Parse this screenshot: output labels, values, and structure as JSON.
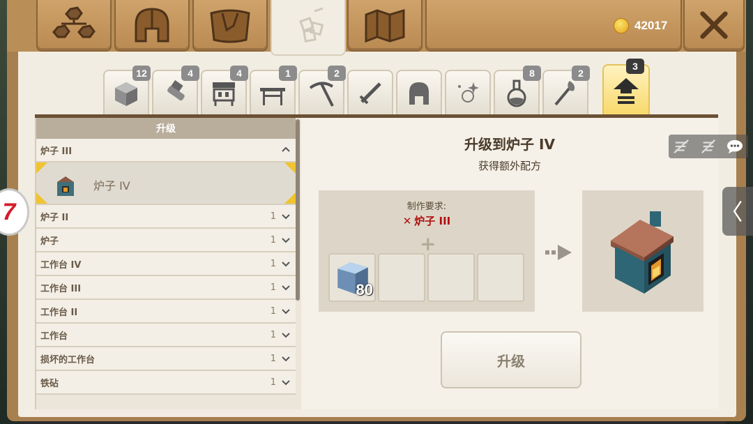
{
  "header": {
    "tabs": [
      {
        "icon": "hierarchy-icon"
      },
      {
        "icon": "helmet-icon"
      },
      {
        "icon": "bag-icon"
      },
      {
        "icon": "crafting-icon",
        "active": true
      },
      {
        "icon": "map-icon"
      }
    ],
    "coins": "42017",
    "close_icon": "close-icon"
  },
  "categories": [
    {
      "icon": "block-icon",
      "count": "12"
    },
    {
      "icon": "tools-icon",
      "count": "4"
    },
    {
      "icon": "machine-icon",
      "count": "4"
    },
    {
      "icon": "table-icon",
      "count": "1"
    },
    {
      "icon": "pickaxe-icon",
      "count": "2"
    },
    {
      "icon": "sword-icon",
      "count": ""
    },
    {
      "icon": "helmet-icon",
      "count": ""
    },
    {
      "icon": "sparkle-icon",
      "count": ""
    },
    {
      "icon": "potion-icon",
      "count": "8"
    },
    {
      "icon": "torch-icon",
      "count": "2"
    },
    {
      "icon": "upgrade-arrow-icon",
      "count": "3",
      "active": true
    }
  ],
  "list": {
    "header": "升级",
    "expanded_group": "炉子 III",
    "selected_item": "炉子 IV",
    "groups": [
      {
        "name": "炉子 II",
        "count": "1"
      },
      {
        "name": "炉子",
        "count": "1"
      },
      {
        "name": "工作台 IV",
        "count": "1"
      },
      {
        "name": "工作台 III",
        "count": "1"
      },
      {
        "name": "工作台 II",
        "count": "1"
      },
      {
        "name": "工作台",
        "count": "1"
      },
      {
        "name": "损坏的工作台",
        "count": "1"
      },
      {
        "name": "铁砧",
        "count": "1"
      }
    ]
  },
  "detail": {
    "title": "升级到炉子 IV",
    "subtitle": "获得额外配方",
    "requirement_label": "制作要求:",
    "requirement_item": "炉子 III",
    "requirement_mark": "✕",
    "plus": "+",
    "slots": [
      {
        "item": "iron-block-icon",
        "count": "80"
      },
      {
        "item": "",
        "count": ""
      },
      {
        "item": "",
        "count": ""
      },
      {
        "item": "",
        "count": ""
      }
    ],
    "result_item": "furnace-icon",
    "upgrade_button": "升级"
  },
  "overlay": {
    "left_badge": "7",
    "chat_icon": "chat-icon"
  },
  "colors": {
    "wood": "#b98e57",
    "paper": "#f2ede2",
    "active_tab": "#f8d86a",
    "requirement_red": "#b01010"
  }
}
